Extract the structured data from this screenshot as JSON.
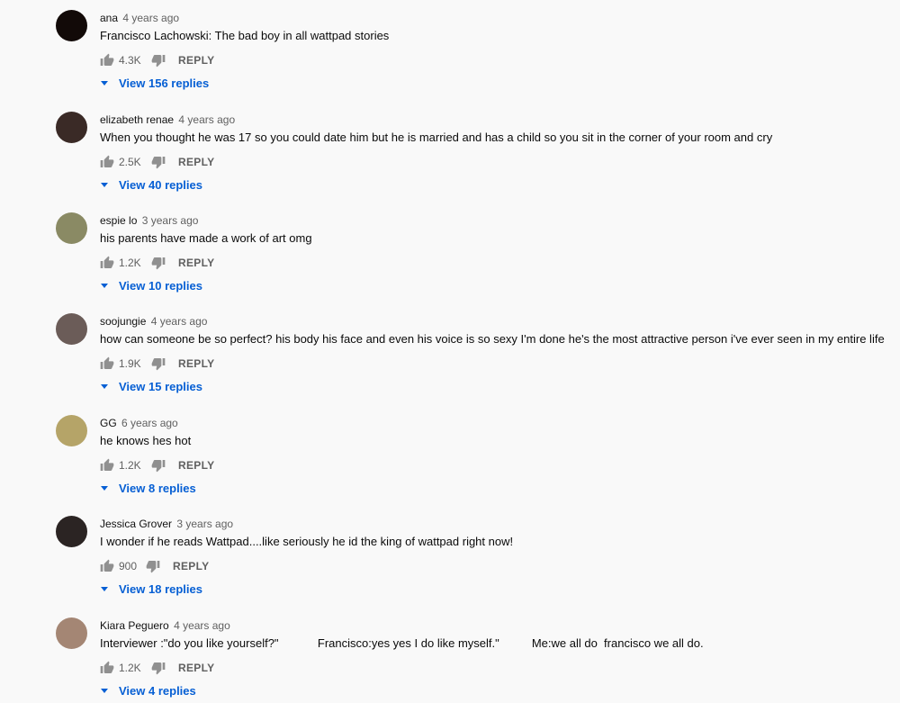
{
  "comments": [
    {
      "author": "ana",
      "time": "4 years ago",
      "text": "Francisco Lachowski: The bad boy in all wattpad stories",
      "likes": "4.3K",
      "reply_label": "REPLY",
      "view_replies": "View 156 replies",
      "avatar_color": "#120a08"
    },
    {
      "author": "elizabeth renae",
      "time": "4 years ago",
      "text": "When you thought he was 17 so you could date him but he is married and has a child so you sit in the corner of your room and cry",
      "likes": "2.5K",
      "reply_label": "REPLY",
      "view_replies": "View 40 replies",
      "avatar_color": "#3a2a26"
    },
    {
      "author": "espie lo",
      "time": "3 years ago",
      "text": "his parents have made a work of art omg",
      "likes": "1.2K",
      "reply_label": "REPLY",
      "view_replies": "View 10 replies",
      "avatar_color": "#8a8a64"
    },
    {
      "author": "soojungie",
      "time": "4 years ago",
      "text": "how can someone be so perfect? his body his face and even his voice is so sexy I'm done he's the most attractive person i've ever seen in my entire life",
      "likes": "1.9K",
      "reply_label": "REPLY",
      "view_replies": "View 15 replies",
      "avatar_color": "#6b5c58"
    },
    {
      "author": "GG",
      "time": "6 years ago",
      "text": "he knows hes hot",
      "likes": "1.2K",
      "reply_label": "REPLY",
      "view_replies": "View 8 replies",
      "avatar_color": "#b5a468"
    },
    {
      "author": "Jessica Grover",
      "time": "3 years ago",
      "text": "I wonder if he reads Wattpad....like seriously he id the king of wattpad right now!",
      "likes": "900",
      "reply_label": "REPLY",
      "view_replies": "View 18 replies",
      "avatar_color": "#2b2423"
    },
    {
      "author": "Kiara Peguero",
      "time": "4 years ago",
      "text": "Interviewer :\"do you like yourself?\"            Francisco:yes yes I do like myself.\"          Me:we all do  francisco we all do.",
      "likes": "1.2K",
      "reply_label": "REPLY",
      "view_replies": "View 4 replies",
      "avatar_color": "#a48674"
    }
  ],
  "colors": {
    "background": "#f9f9f9",
    "link_blue": "#065fd4",
    "meta_grey": "#606060"
  },
  "icons": {
    "like": "thumbs-up-icon",
    "dislike": "thumbs-down-icon",
    "expand": "caret-down-icon"
  }
}
